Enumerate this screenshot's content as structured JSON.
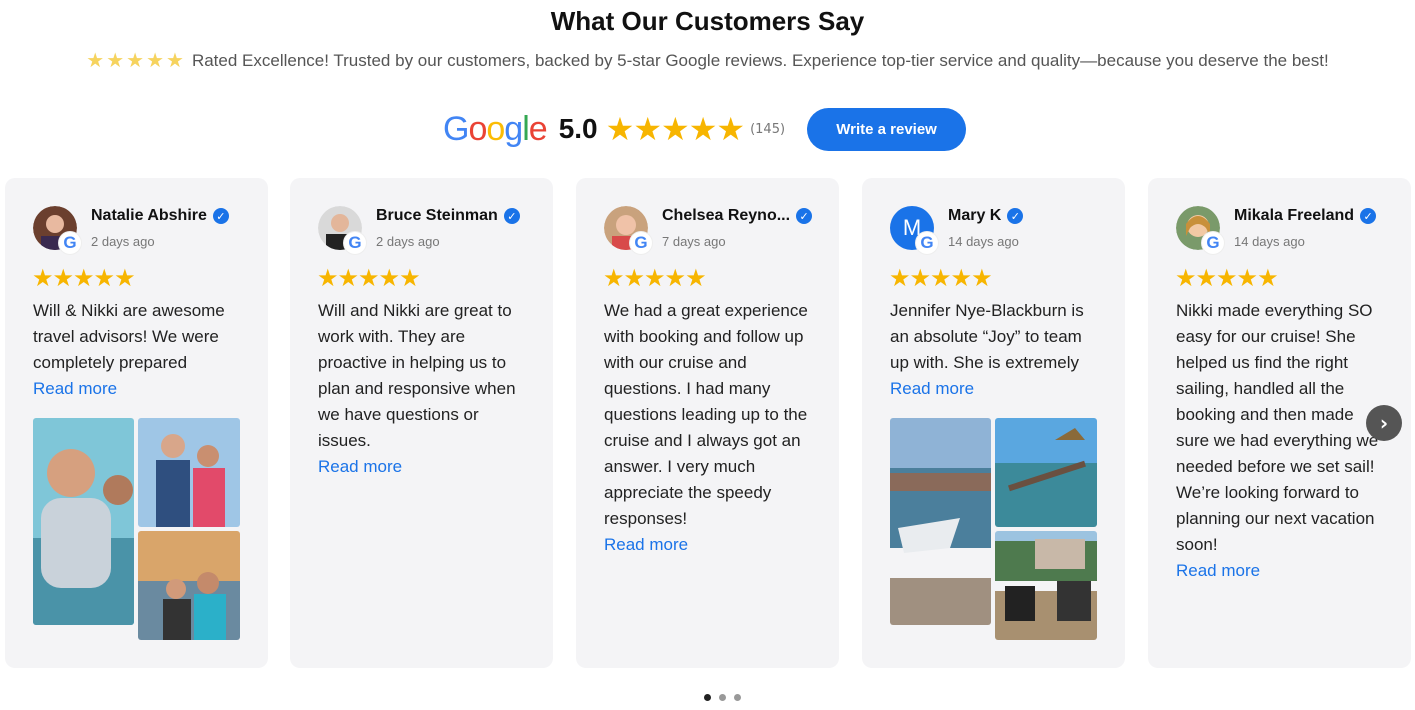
{
  "header": {
    "title": "What Our Customers Say",
    "stars": "★★★★★",
    "tagline": "Rated Excellence! Trusted by our customers, backed by 5-star Google reviews. Experience top-tier service and quality—because you deserve the best!"
  },
  "summary": {
    "logo_letters": [
      "G",
      "o",
      "o",
      "g",
      "l",
      "e"
    ],
    "score": "5.0",
    "stars": "★★★★★",
    "rating": 5,
    "count": "(145)",
    "write_label": "Write a review"
  },
  "colors": {
    "accent": "#1a73e8",
    "star": "#f7b500",
    "card_bg": "#f4f4f6"
  },
  "reviews": [
    {
      "name": "Natalie Abshire",
      "date": "2 days ago",
      "stars": "★★★★★",
      "text": "Will & Nikki are awesome travel advisors! We were completely prepared",
      "read_more": "Read more",
      "has_photos": true
    },
    {
      "name": "Bruce Steinman",
      "date": "2 days ago",
      "stars": "★★★★★",
      "text": "Will and Nikki are great to work with. They are proactive in helping us to plan and responsive when we have questions or issues.",
      "read_more": "Read more",
      "has_photos": false
    },
    {
      "name": "Chelsea Reyno...",
      "date": "7 days ago",
      "stars": "★★★★★",
      "text": "We had a great experience with booking and follow up with our cruise and questions. I had many questions leading up to the cruise and I always got an answer. I very much appreciate the speedy responses!",
      "read_more": "Read more",
      "has_photos": false
    },
    {
      "name": "Mary K",
      "initial": "M",
      "date": "14 days ago",
      "stars": "★★★★★",
      "text": "Jennifer Nye-Blackburn is an absolute “Joy” to team up with. She is extremely",
      "read_more": "Read more",
      "has_photos": true
    },
    {
      "name": "Mikala Freeland",
      "date": "14 days ago",
      "stars": "★★★★★",
      "text": "Nikki made everything SO easy for our cruise! She helped us find the right sailing, handled all the booking and then made sure we had everything we needed before we set sail! We’re looking forward to planning our next vacation soon!",
      "read_more": "Read more",
      "has_photos": false
    }
  ],
  "badge_letter": "G",
  "verified_mark": "✓",
  "next_arrow": "›",
  "pagination": {
    "total": 3,
    "active": 1
  }
}
